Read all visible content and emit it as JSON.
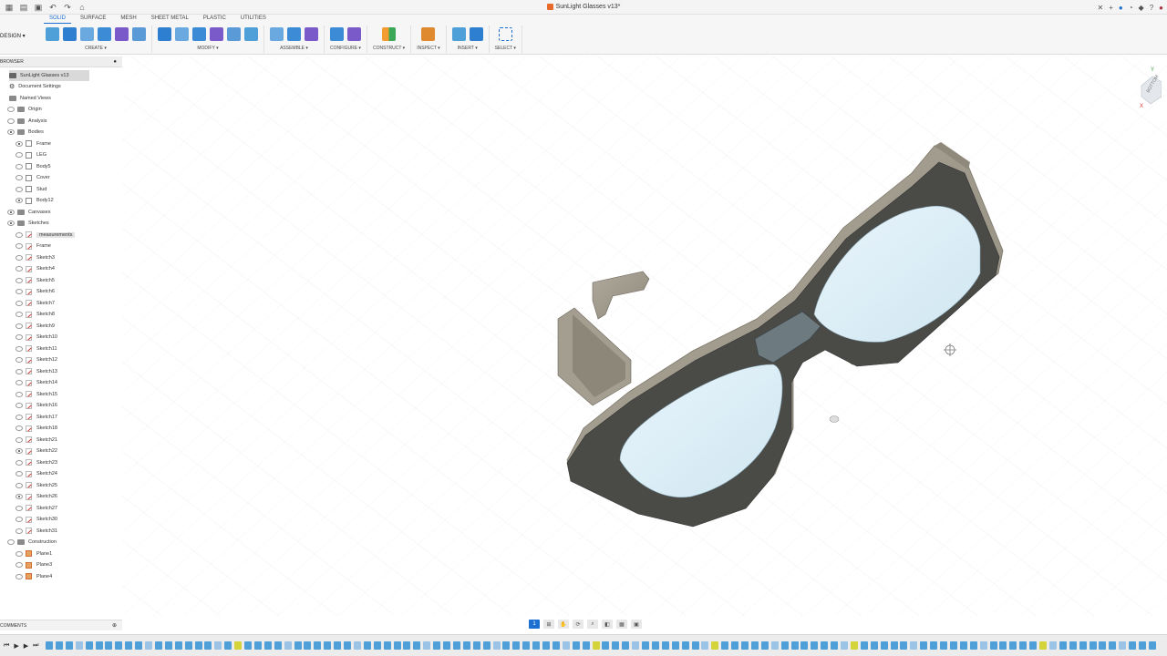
{
  "titlebar": {
    "doc_title": "SunLight Glasses v13*"
  },
  "toolbar": {
    "workspace": "DESIGN",
    "tabs": [
      "SOLID",
      "SURFACE",
      "MESH",
      "SHEET METAL",
      "PLASTIC",
      "UTILITIES"
    ],
    "active_tab": "SOLID",
    "groups": [
      {
        "label": "CREATE",
        "icons": [
          "new-component-icon",
          "extrude-icon",
          "revolve-icon",
          "hole-icon",
          "pattern-icon",
          "form-icon"
        ]
      },
      {
        "label": "MODIFY",
        "icons": [
          "press-pull-icon",
          "fillet-icon",
          "shell-icon",
          "combine-icon",
          "split-icon",
          "move-icon"
        ]
      },
      {
        "label": "ASSEMBLE",
        "icons": [
          "joint-icon",
          "new-component-icon",
          "as-built-joint-icon"
        ]
      },
      {
        "label": "CONFIGURE",
        "icons": [
          "configure-icon",
          "table-icon"
        ]
      },
      {
        "label": "CONSTRUCT",
        "icons": [
          "plane-icon"
        ]
      },
      {
        "label": "INSPECT",
        "icons": [
          "measure-icon"
        ]
      },
      {
        "label": "INSERT",
        "icons": [
          "insert-mesh-icon",
          "insert-image-icon"
        ]
      },
      {
        "label": "SELECT",
        "icons": [
          "select-icon"
        ]
      }
    ]
  },
  "browser": {
    "header": "BROWSER",
    "root": "SunLight Glasses v13",
    "items": [
      {
        "label": "Document Settings",
        "level": 1,
        "kind": "gear",
        "eye": false
      },
      {
        "label": "Named Views",
        "level": 1,
        "kind": "folder",
        "eye": false
      },
      {
        "label": "Origin",
        "level": 1,
        "kind": "folder",
        "eye": true,
        "visible": false
      },
      {
        "label": "Analysis",
        "level": 1,
        "kind": "folder",
        "eye": true,
        "visible": false
      },
      {
        "label": "Bodies",
        "level": 1,
        "kind": "folder",
        "eye": true,
        "visible": true
      },
      {
        "label": "Frame",
        "level": 2,
        "kind": "body",
        "eye": true,
        "visible": true
      },
      {
        "label": "LEG",
        "level": 2,
        "kind": "body",
        "eye": true,
        "visible": false
      },
      {
        "label": "Body5",
        "level": 2,
        "kind": "body",
        "eye": true,
        "visible": false
      },
      {
        "label": "Cover",
        "level": 2,
        "kind": "body",
        "eye": true,
        "visible": false
      },
      {
        "label": "Stud",
        "level": 2,
        "kind": "body",
        "eye": true,
        "visible": false
      },
      {
        "label": "Body12",
        "level": 2,
        "kind": "body",
        "eye": true,
        "visible": true
      },
      {
        "label": "Canvases",
        "level": 1,
        "kind": "folder",
        "eye": true,
        "visible": true
      },
      {
        "label": "Sketches",
        "level": 1,
        "kind": "folder",
        "eye": true,
        "visible": true
      },
      {
        "label": "measurements",
        "level": 2,
        "kind": "sketch",
        "eye": true,
        "visible": false
      },
      {
        "label": "Frame",
        "level": 2,
        "kind": "sketch",
        "eye": true,
        "visible": false
      },
      {
        "label": "Sketch3",
        "level": 2,
        "kind": "sketch",
        "eye": true,
        "visible": false
      },
      {
        "label": "Sketch4",
        "level": 2,
        "kind": "sketch",
        "eye": true,
        "visible": false
      },
      {
        "label": "Sketch5",
        "level": 2,
        "kind": "sketch",
        "eye": true,
        "visible": false
      },
      {
        "label": "Sketch6",
        "level": 2,
        "kind": "sketch",
        "eye": true,
        "visible": false
      },
      {
        "label": "Sketch7",
        "level": 2,
        "kind": "sketch",
        "eye": true,
        "visible": false
      },
      {
        "label": "Sketch8",
        "level": 2,
        "kind": "sketch",
        "eye": true,
        "visible": false
      },
      {
        "label": "Sketch9",
        "level": 2,
        "kind": "sketch",
        "eye": true,
        "visible": false
      },
      {
        "label": "Sketch10",
        "level": 2,
        "kind": "sketch",
        "eye": true,
        "visible": false
      },
      {
        "label": "Sketch11",
        "level": 2,
        "kind": "sketch",
        "eye": true,
        "visible": false
      },
      {
        "label": "Sketch12",
        "level": 2,
        "kind": "sketch",
        "eye": true,
        "visible": false
      },
      {
        "label": "Sketch13",
        "level": 2,
        "kind": "sketch",
        "eye": true,
        "visible": false
      },
      {
        "label": "Sketch14",
        "level": 2,
        "kind": "sketch",
        "eye": true,
        "visible": false
      },
      {
        "label": "Sketch15",
        "level": 2,
        "kind": "sketch",
        "eye": true,
        "visible": false
      },
      {
        "label": "Sketch16",
        "level": 2,
        "kind": "sketch",
        "eye": true,
        "visible": false
      },
      {
        "label": "Sketch17",
        "level": 2,
        "kind": "sketch",
        "eye": true,
        "visible": false
      },
      {
        "label": "Sketch18",
        "level": 2,
        "kind": "sketch",
        "eye": true,
        "visible": false
      },
      {
        "label": "Sketch21",
        "level": 2,
        "kind": "sketch",
        "eye": true,
        "visible": false
      },
      {
        "label": "Sketch22",
        "level": 2,
        "kind": "sketch",
        "eye": true,
        "visible": true
      },
      {
        "label": "Sketch23",
        "level": 2,
        "kind": "sketch",
        "eye": true,
        "visible": false
      },
      {
        "label": "Sketch24",
        "level": 2,
        "kind": "sketch",
        "eye": true,
        "visible": false
      },
      {
        "label": "Sketch25",
        "level": 2,
        "kind": "sketch",
        "eye": true,
        "visible": false
      },
      {
        "label": "Sketch26",
        "level": 2,
        "kind": "sketch",
        "eye": true,
        "visible": true
      },
      {
        "label": "Sketch27",
        "level": 2,
        "kind": "sketch",
        "eye": true,
        "visible": false
      },
      {
        "label": "Sketch30",
        "level": 2,
        "kind": "sketch",
        "eye": true,
        "visible": false
      },
      {
        "label": "Sketch31",
        "level": 2,
        "kind": "sketch",
        "eye": true,
        "visible": false
      },
      {
        "label": "Construction",
        "level": 1,
        "kind": "folder",
        "eye": true,
        "visible": false
      },
      {
        "label": "Plane1",
        "level": 2,
        "kind": "plane",
        "eye": true,
        "visible": false
      },
      {
        "label": "Plane3",
        "level": 2,
        "kind": "plane",
        "eye": true,
        "visible": false
      },
      {
        "label": "Plane4",
        "level": 2,
        "kind": "plane",
        "eye": true,
        "visible": false
      }
    ]
  },
  "comments": {
    "header": "COMMENTS"
  },
  "viewcube": {
    "face": "BOTTOM",
    "axis_y": "Y",
    "axis_x": "X"
  },
  "navbar": {
    "items": [
      "1"
    ]
  },
  "colors": {
    "accent": "#1a6fd0",
    "frame": "#4a4a47",
    "frame_edge": "#9a9487",
    "lens": "#dceff7",
    "timeline_blue": "#4f9fd8",
    "timeline_yellow": "#d4d43a"
  },
  "timeline": {
    "controls": [
      "first-icon",
      "play-icon",
      "next-icon",
      "last-icon"
    ]
  }
}
